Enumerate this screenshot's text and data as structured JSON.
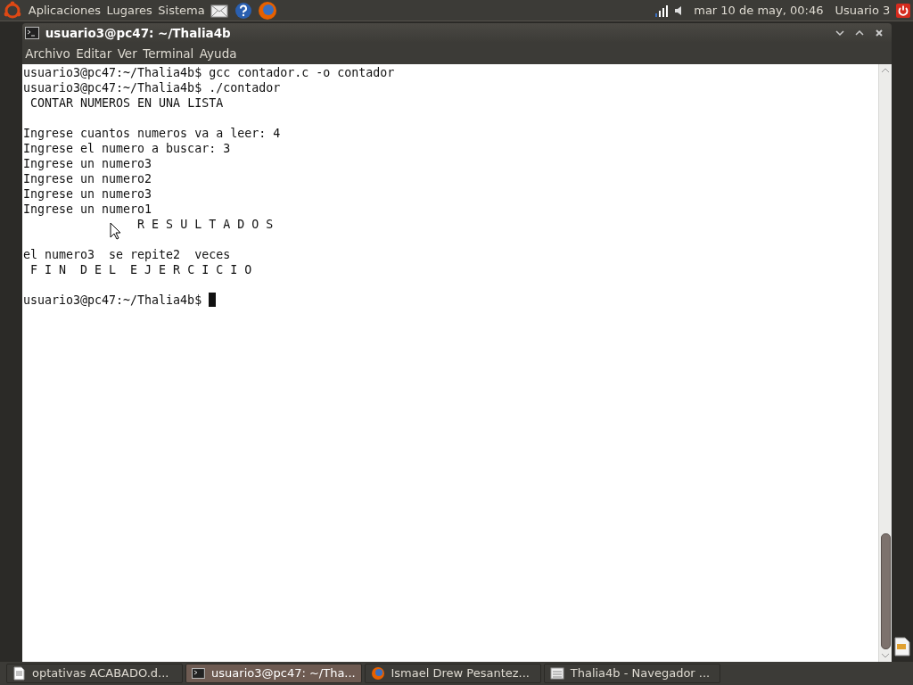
{
  "top_panel": {
    "menus": [
      "Aplicaciones",
      "Lugares",
      "Sistema"
    ],
    "clock": "mar 10 de may, 00:46",
    "user": "Usuario 3"
  },
  "window": {
    "title": "usuario3@pc47: ~/Thalia4b",
    "menu": [
      "Archivo",
      "Editar",
      "Ver",
      "Terminal",
      "Ayuda"
    ]
  },
  "terminal": {
    "lines": [
      {
        "kind": "text",
        "text": "usuario3@pc47:~/Thalia4b$ gcc contador.c -o contador",
        "cursor": false
      },
      {
        "kind": "text",
        "text": "usuario3@pc47:~/Thalia4b$ ./contador",
        "cursor": false
      },
      {
        "kind": "text",
        "text": " CONTAR NUMEROS EN UNA LISTA",
        "cursor": false
      },
      {
        "kind": "blank"
      },
      {
        "kind": "text",
        "text": "Ingrese cuantos numeros va a leer: 4",
        "cursor": false
      },
      {
        "kind": "text",
        "text": "Ingrese el numero a buscar: 3",
        "cursor": false
      },
      {
        "kind": "text",
        "text": "Ingrese un numero3",
        "cursor": false
      },
      {
        "kind": "text",
        "text": "Ingrese un numero2",
        "cursor": false
      },
      {
        "kind": "text",
        "text": "Ingrese un numero3",
        "cursor": false
      },
      {
        "kind": "text",
        "text": "Ingrese un numero1",
        "cursor": false
      },
      {
        "kind": "text",
        "text": "                R E S U L T A D O S",
        "cursor": false
      },
      {
        "kind": "blank"
      },
      {
        "kind": "text",
        "text": "el numero3  se repite2  veces",
        "cursor": false
      },
      {
        "kind": "text",
        "text": " F I N  D E L  E J E R C I C I O",
        "cursor": false
      },
      {
        "kind": "blank"
      },
      {
        "kind": "text",
        "text": "usuario3@pc47:~/Thalia4b$ ",
        "cursor": true
      }
    ]
  },
  "taskbar": [
    {
      "label": "optativas ACABADO.d...",
      "kind": "document",
      "selected": false
    },
    {
      "label": "usuario3@pc47: ~/Tha...",
      "kind": "terminal",
      "selected": true
    },
    {
      "label": "Ismael Drew Pesantez...",
      "kind": "browser",
      "selected": false
    },
    {
      "label": "Thalia4b - Navegador ...",
      "kind": "folder",
      "selected": false
    }
  ]
}
